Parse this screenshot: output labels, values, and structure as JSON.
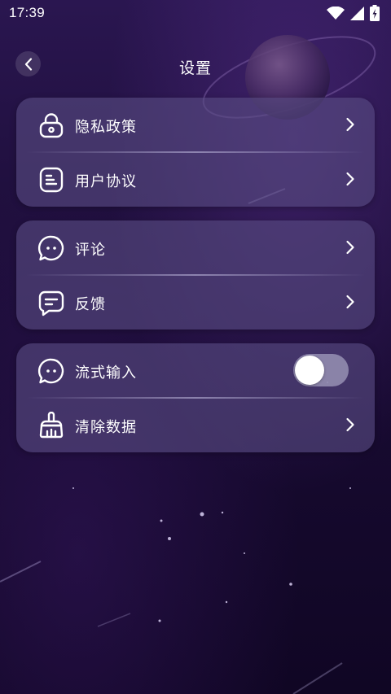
{
  "status_bar": {
    "time": "17:39"
  },
  "header": {
    "title": "设置"
  },
  "groups": [
    {
      "items": [
        {
          "label": "隐私政策",
          "icon": "lock-icon"
        },
        {
          "label": "用户协议",
          "icon": "document-icon"
        }
      ]
    },
    {
      "items": [
        {
          "label": "评论",
          "icon": "chat-bubble-icon"
        },
        {
          "label": "反馈",
          "icon": "feedback-icon"
        }
      ]
    },
    {
      "items": [
        {
          "label": "流式输入",
          "icon": "chat-bubble-icon",
          "toggle": "off"
        },
        {
          "label": "清除数据",
          "icon": "brush-icon"
        }
      ]
    }
  ],
  "colors": {
    "background": "#1f0f3d",
    "card": "#584c82",
    "toggle_track": "#9690b4"
  }
}
